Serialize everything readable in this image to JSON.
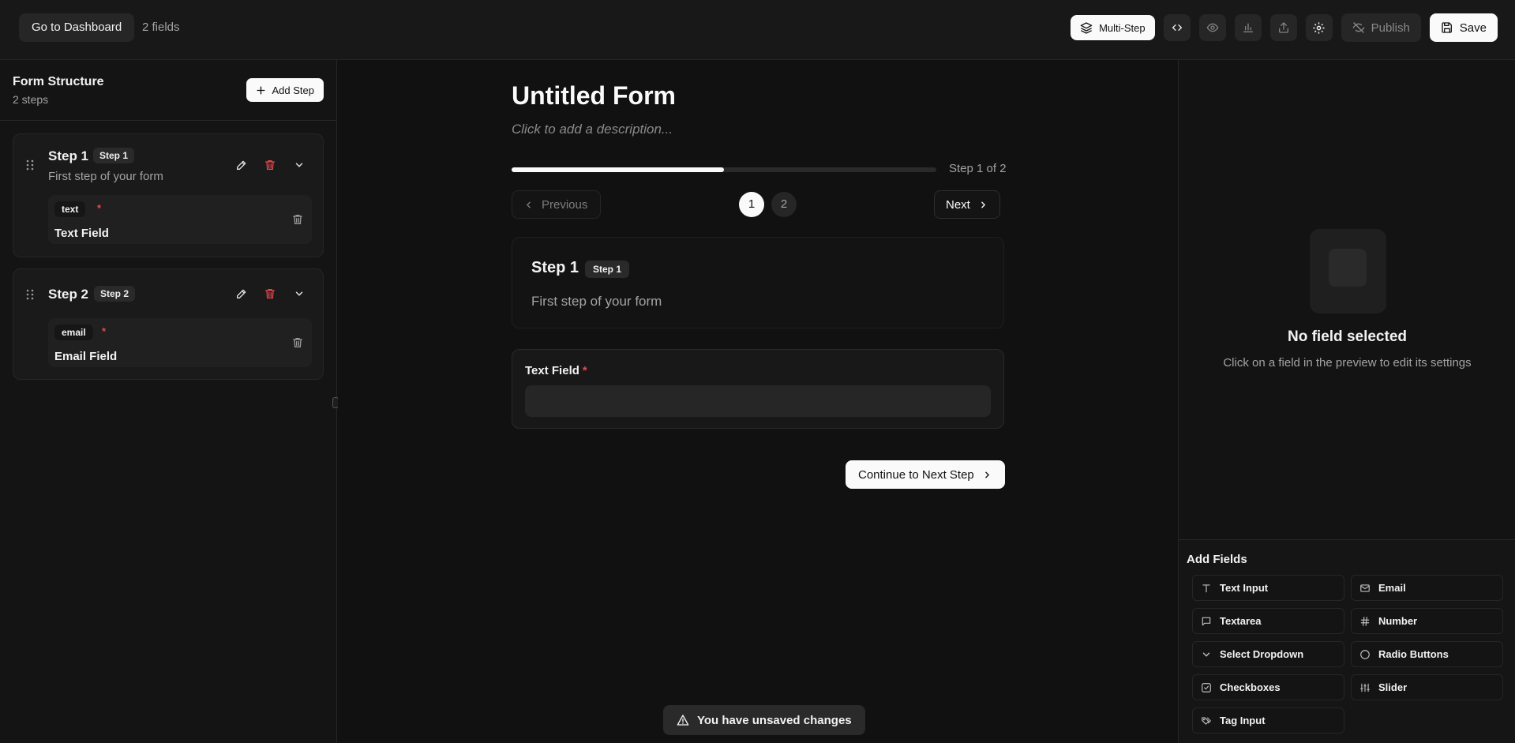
{
  "topbar": {
    "dashboard_label": "Go to Dashboard",
    "field_count": "2 fields",
    "multistep_label": "Multi-Step",
    "publish_label": "Publish",
    "save_label": "Save"
  },
  "structure": {
    "title": "Form Structure",
    "subtitle": "2 steps",
    "add_step_label": "Add Step",
    "steps": [
      {
        "name": "Step 1",
        "badge": "Step 1",
        "description": "First step of your form",
        "field_type": "text",
        "field_label": "Text Field"
      },
      {
        "name": "Step 2",
        "badge": "Step 2",
        "field_type": "email",
        "field_label": "Email Field"
      }
    ]
  },
  "preview": {
    "title": "Untitled Form",
    "description_placeholder": "Click to add a description...",
    "progress": 0.5,
    "progress_text": "Step 1 of 2",
    "prev_label": "Previous",
    "next_label": "Next",
    "pages": [
      "1",
      "2"
    ],
    "current_step": {
      "name": "Step 1",
      "badge": "Step 1",
      "description": "First step of your form"
    },
    "field_label": "Text Field",
    "required_mark": "*",
    "continue_label": "Continue to Next Step",
    "unsaved_notice": "You have unsaved changes"
  },
  "inspector": {
    "empty_title": "No field selected",
    "empty_subtitle": "Click on a field in the preview to edit its settings",
    "add_fields_title": "Add Fields",
    "field_types": [
      {
        "label": "Text Input",
        "icon": "text-icon"
      },
      {
        "label": "Email",
        "icon": "mail-icon"
      },
      {
        "label": "Textarea",
        "icon": "message-icon"
      },
      {
        "label": "Number",
        "icon": "hash-icon"
      },
      {
        "label": "Select Dropdown",
        "icon": "chevron-down-icon"
      },
      {
        "label": "Radio Buttons",
        "icon": "circle-icon"
      },
      {
        "label": "Checkboxes",
        "icon": "checkbox-icon"
      },
      {
        "label": "Slider",
        "icon": "sliders-icon"
      },
      {
        "label": "Tag Input",
        "icon": "tags-icon"
      }
    ]
  },
  "colors": {
    "background": "#111111",
    "panel": "#141414",
    "accent": "#fafafa",
    "danger": "#e5484d"
  }
}
